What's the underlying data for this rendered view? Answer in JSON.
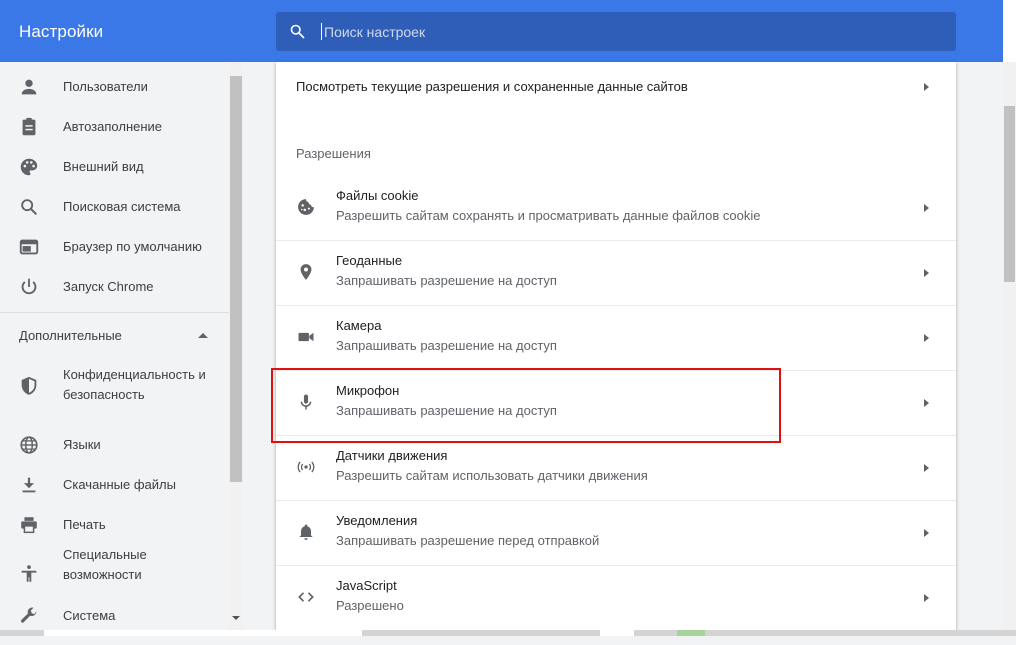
{
  "header": {
    "title": "Настройки",
    "search_placeholder": "Поиск настроек"
  },
  "sidebar": {
    "items": [
      {
        "label": "Пользователи",
        "icon": "person-icon"
      },
      {
        "label": "Автозаполнение",
        "icon": "clipboard-icon"
      },
      {
        "label": "Внешний вид",
        "icon": "palette-icon"
      },
      {
        "label": "Поисковая система",
        "icon": "search-icon"
      },
      {
        "label": "Браузер по умолчанию",
        "icon": "browser-window-icon"
      },
      {
        "label": "Запуск Chrome",
        "icon": "power-icon"
      }
    ],
    "advanced_section": "Дополнительные",
    "advanced_items": [
      {
        "label": "Конфиденциальность и безопасность",
        "icon": "shield-icon"
      },
      {
        "label": "Языки",
        "icon": "globe-icon"
      },
      {
        "label": "Скачанные файлы",
        "icon": "download-icon"
      },
      {
        "label": "Печать",
        "icon": "printer-icon"
      },
      {
        "label": "Специальные возможности",
        "icon": "accessibility-icon"
      },
      {
        "label": "Система",
        "icon": "wrench-icon"
      }
    ]
  },
  "main": {
    "top_link": "Посмотреть текущие разрешения и сохраненные данные сайтов",
    "section_title": "Разрешения",
    "permissions": [
      {
        "title": "Файлы cookie",
        "subtitle": "Разрешить сайтам сохранять и просматривать данные файлов cookie",
        "icon": "cookie-icon"
      },
      {
        "title": "Геоданные",
        "subtitle": "Запрашивать разрешение на доступ",
        "icon": "location-pin-icon"
      },
      {
        "title": "Камера",
        "subtitle": "Запрашивать разрешение на доступ",
        "icon": "camera-icon"
      },
      {
        "title": "Микрофон",
        "subtitle": "Запрашивать разрешение на доступ",
        "icon": "microphone-icon"
      },
      {
        "title": "Датчики движения",
        "subtitle": "Разрешить сайтам использовать датчики движения",
        "icon": "motion-sensor-icon"
      },
      {
        "title": "Уведомления",
        "subtitle": "Запрашивать разрешение перед отправкой",
        "icon": "bell-icon"
      },
      {
        "title": "JavaScript",
        "subtitle": "Разрешено",
        "icon": "code-icon"
      }
    ]
  },
  "colors": {
    "header": "#3b78e7",
    "search_bg": "#2f5eb8",
    "highlight": "#e01010"
  }
}
